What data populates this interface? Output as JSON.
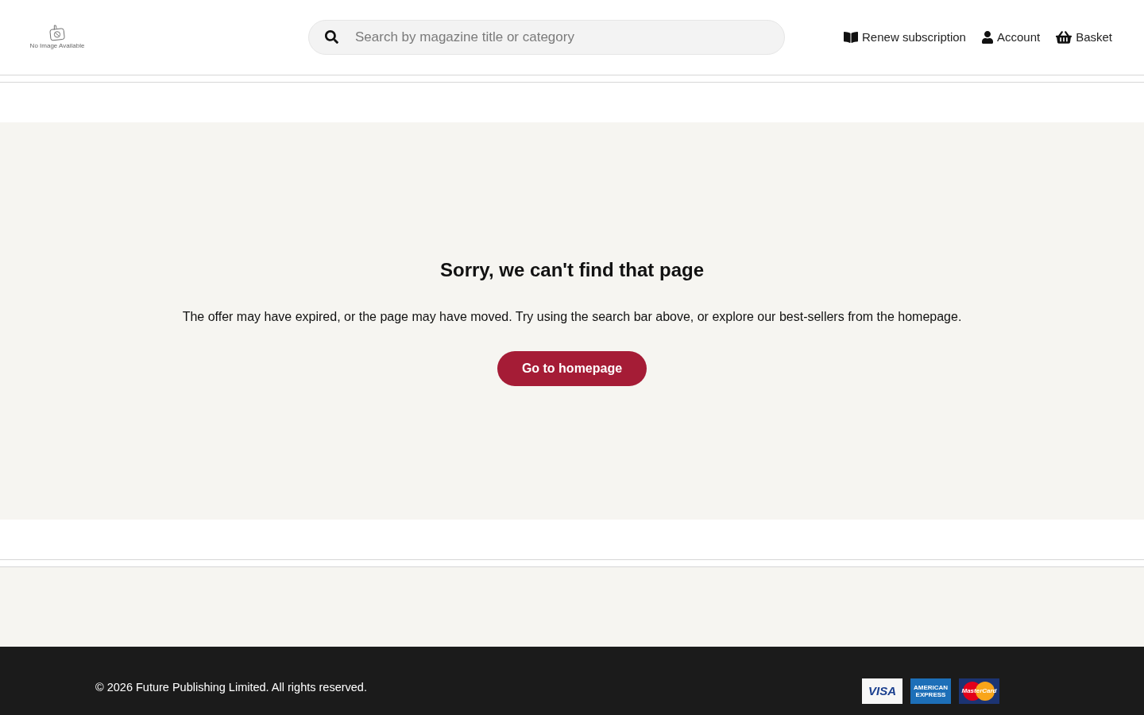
{
  "header": {
    "logo": {
      "caption": "No Image Available"
    },
    "search": {
      "placeholder": "Search by magazine title or category"
    },
    "nav": [
      {
        "kind": "renew",
        "label": "Renew subscription"
      },
      {
        "kind": "account",
        "label": "Account"
      },
      {
        "kind": "basket",
        "label": "Basket"
      }
    ]
  },
  "error": {
    "title": "Sorry, we can't find that page",
    "message": "The offer may have expired, or the page may have moved. Try using the search bar above, or explore our best-sellers from the homepage.",
    "button": "Go to homepage"
  },
  "footer": {
    "copyright": "© 2026 Future Publishing Limited. All rights reserved.",
    "payment_cards": [
      {
        "kind": "visa",
        "label": "VISA"
      },
      {
        "kind": "amex",
        "label": "AMERICAN EXPRESS"
      },
      {
        "kind": "mastercard",
        "label": "MasterCard"
      }
    ]
  }
}
